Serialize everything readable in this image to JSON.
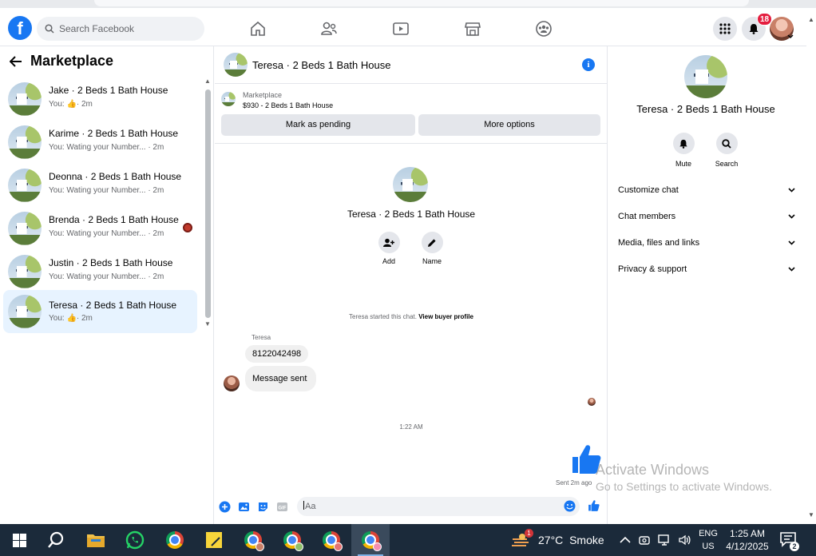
{
  "topbar": {
    "logo_letter": "f",
    "search_placeholder": "Search Facebook",
    "notification_count": "18",
    "nav_icons": [
      "home-icon",
      "friends-icon",
      "watch-icon",
      "marketplace-icon",
      "groups-icon"
    ]
  },
  "sidebar": {
    "title": "Marketplace",
    "conversations": [
      {
        "name": "Jake · 2 Beds 1 Bath House",
        "preview": "You:",
        "time": "· 2m",
        "liked": true
      },
      {
        "name": "Karime · 2 Beds 1 Bath House",
        "preview": "You: Wating your Number... · 2m"
      },
      {
        "name": "Deonna · 2 Beds 1 Bath House",
        "preview": "You: Wating your Number... · 2m"
      },
      {
        "name": "Brenda · 2 Beds 1 Bath House",
        "preview": "You: Wating your Number... · 2m"
      },
      {
        "name": "Justin · 2 Beds 1 Bath House",
        "preview": "You: Wating your Number... · 2m"
      },
      {
        "name": "Teresa · 2 Beds 1 Bath House",
        "preview": "You:",
        "time": "· 2m",
        "liked": true,
        "active": true
      }
    ]
  },
  "chat": {
    "title": "Teresa · 2 Beds 1 Bath House",
    "listing_source": "Marketplace",
    "listing_price": "$930 - 2 Beds 1 Bath House",
    "mark_pending": "Mark as pending",
    "more_options": "More options",
    "profile_name": "Teresa · 2 Beds 1 Bath House",
    "action_add": "Add",
    "action_name": "Name",
    "system_text": "Teresa started this chat.",
    "system_link": "View buyer profile",
    "sender": "Teresa",
    "message_1": "8122042498",
    "message_2": "Message sent",
    "timestamp": "1:22 AM",
    "sent_status": "Sent 2m ago",
    "composer_placeholder": "Aa"
  },
  "details": {
    "name": "Teresa · 2 Beds 1 Bath House",
    "mute": "Mute",
    "search": "Search",
    "sections": [
      "Customize chat",
      "Chat members",
      "Media, files and links",
      "Privacy & support"
    ]
  },
  "watermark": {
    "line1": "Activate Windows",
    "line2": "Go to Settings to activate Windows."
  },
  "taskbar": {
    "weather_temp": "27°C",
    "weather_text": "Smoke",
    "weather_alert": "1",
    "lang": "ENG",
    "region": "US",
    "time": "1:25 AM",
    "date": "4/12/2025",
    "notif_count": "2"
  },
  "colors": {
    "brand": "#1877f2",
    "active_conv": "#e7f3ff",
    "taskbar": "#1b2a3a"
  }
}
